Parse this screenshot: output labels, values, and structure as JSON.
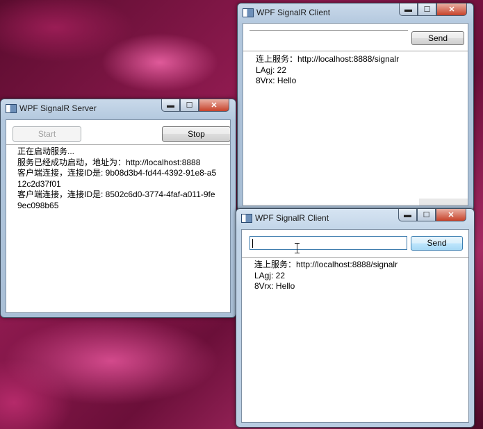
{
  "server": {
    "title": "WPF SignalR Server",
    "start_label": "Start",
    "stop_label": "Stop",
    "log": "正在启动服务...\n服务已经成功启动，地址为：http://localhost:8888\n客户端连接，连接ID是: 9b08d3b4-fd44-4392-91e8-a512c2d37f01\n客户端连接，连接ID是: 8502c6d0-3774-4faf-a011-9fe9ec098b65"
  },
  "client1": {
    "title": "WPF SignalR Client",
    "input_value": "",
    "send_label": "Send",
    "log": "连上服务：http://localhost:8888/signalr\nLAgj: 22\n8Vrx: Hello"
  },
  "client2": {
    "title": "WPF SignalR Client",
    "input_value": "",
    "send_label": "Send",
    "log": "连上服务：http://localhost:8888/signalr\nLAgj: 22\n8Vrx: Hello"
  },
  "caption_buttons": {
    "minimize": "▬",
    "maximize": "☐",
    "close": "✕"
  }
}
